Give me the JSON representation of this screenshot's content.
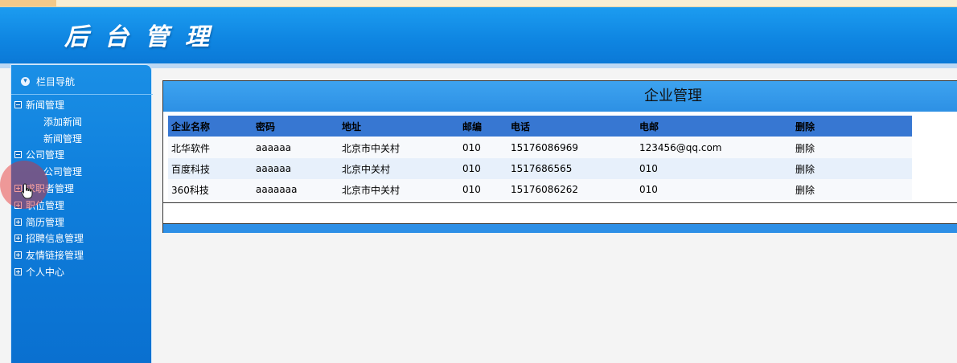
{
  "header": {
    "title": "后台管理"
  },
  "sidebar": {
    "heading": "栏目导航",
    "items": [
      {
        "label": "新闻管理",
        "expanded": true,
        "level": 0
      },
      {
        "label": "添加新闻",
        "level": 1
      },
      {
        "label": "新闻管理",
        "level": 1
      },
      {
        "label": "公司管理",
        "expanded": true,
        "level": 0
      },
      {
        "label": "公司管理",
        "level": 1
      },
      {
        "label": "求职者管理",
        "expanded": false,
        "level": 0
      },
      {
        "label": "职位管理",
        "expanded": false,
        "level": 0
      },
      {
        "label": "简历管理",
        "expanded": false,
        "level": 0
      },
      {
        "label": "招聘信息管理",
        "expanded": false,
        "level": 0
      },
      {
        "label": "友情链接管理",
        "expanded": false,
        "level": 0
      },
      {
        "label": "个人中心",
        "expanded": false,
        "level": 0
      }
    ]
  },
  "main": {
    "title": "企业管理",
    "columns": [
      "企业名称",
      "密码",
      "地址",
      "邮编",
      "电话",
      "电邮",
      "删除"
    ],
    "rows": [
      [
        "北华软件",
        "aaaaaa",
        "北京市中关村",
        "010",
        "15176086969",
        "123456@qq.com",
        "删除"
      ],
      [
        "百度科技",
        "aaaaaa",
        "北京中关村",
        "010",
        "1517686565",
        "010",
        "删除"
      ],
      [
        "360科技",
        "aaaaaaa",
        "北京市中关村",
        "010",
        "15176086262",
        "010",
        "删除"
      ]
    ]
  },
  "colors": {
    "header": "#0f86e2",
    "sidebar": "#0f7fdc",
    "table_header": "#3777d2"
  }
}
